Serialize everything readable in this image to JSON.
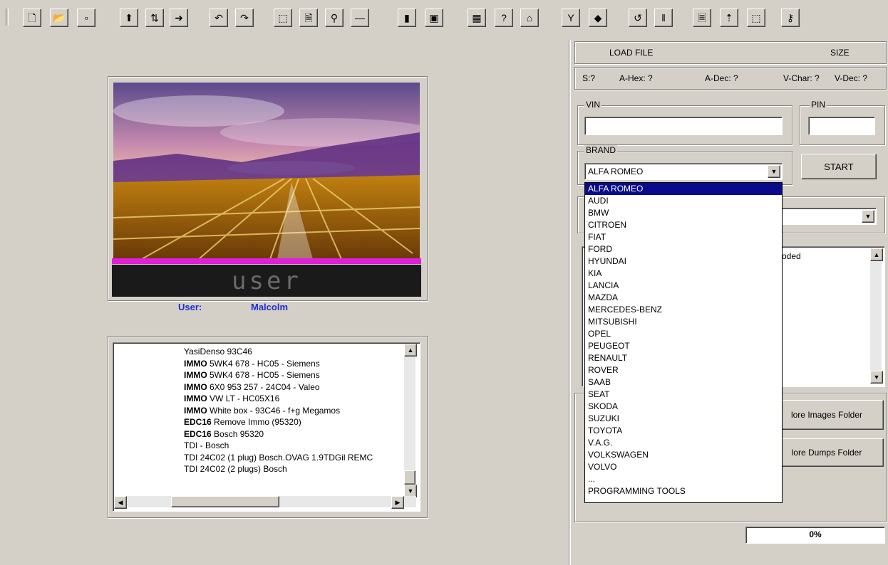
{
  "toolbar": {
    "buttons": [
      {
        "name": "new-file",
        "glyph": "🗋"
      },
      {
        "name": "open-folder",
        "glyph": "📂"
      },
      {
        "name": "disabled-1",
        "glyph": "▫"
      },
      {
        "name": "import",
        "glyph": "⬆"
      },
      {
        "name": "transfer",
        "glyph": "⇅"
      },
      {
        "name": "export",
        "glyph": "➜"
      },
      {
        "name": "undo",
        "glyph": "↶"
      },
      {
        "name": "redo",
        "glyph": "↷"
      },
      {
        "name": "select",
        "glyph": "⬚"
      },
      {
        "name": "page",
        "glyph": "🗎"
      },
      {
        "name": "find",
        "glyph": "⚲"
      },
      {
        "name": "minus",
        "glyph": "—"
      },
      {
        "name": "chip",
        "glyph": "▮"
      },
      {
        "name": "window",
        "glyph": "▣"
      },
      {
        "name": "calc",
        "glyph": "▦"
      },
      {
        "name": "help",
        "glyph": "?"
      },
      {
        "name": "book",
        "glyph": "⌂"
      },
      {
        "name": "tools",
        "glyph": "Y"
      },
      {
        "name": "chip-dark",
        "glyph": "◆"
      },
      {
        "name": "refresh",
        "glyph": "↺"
      },
      {
        "name": "columns",
        "glyph": "‖"
      },
      {
        "name": "document",
        "glyph": "🗏"
      },
      {
        "name": "pointer",
        "glyph": "⇡"
      },
      {
        "name": "marquee",
        "glyph": "⬚"
      },
      {
        "name": "key",
        "glyph": "⚷"
      }
    ]
  },
  "splash": {
    "banner_text": "user",
    "user_label": "User:",
    "user_name": "Malcolm"
  },
  "file_list": {
    "items": [
      {
        "bold": "",
        "text": "YasiDenso  93C46"
      },
      {
        "bold": "IMMO",
        "text": " 5WK4 678    - HC05 - Siemens"
      },
      {
        "bold": "IMMO",
        "text": " 5WK4 678    - HC05 - Siemens"
      },
      {
        "bold": "IMMO",
        "text": " 6X0 953 257 - 24C04 - Valeo"
      },
      {
        "bold": "IMMO",
        "text": " VW LT      - HC05X16"
      },
      {
        "bold": "IMMO",
        "text": " White box  - 93C46 - f+g Megamos"
      },
      {
        "bold": "EDC16",
        "text": "  Remove Immo (95320)"
      },
      {
        "bold": "EDC16",
        "text": " Bosch 95320"
      },
      {
        "bold": "",
        "text": "TDI - Bosch"
      },
      {
        "bold": "",
        "text": "TDI 24C02 (1 plug) Bosch.OVAG 1.9TDGil REMC"
      },
      {
        "bold": "",
        "text": "TDI 24C02 (2 plugs) Bosch"
      }
    ]
  },
  "right": {
    "load_file": "LOAD FILE",
    "size": "SIZE",
    "s_label": "S:?",
    "ahex": "A-Hex: ?",
    "adec": "A-Dec: ?",
    "vchar": "V-Char: ?",
    "vdec": "V-Dec: ?",
    "vin_label": "VIN",
    "vin_value": "",
    "pin_label": "PIN",
    "pin_value": "",
    "brand_label": "BRAND",
    "brand_selected": "ALFA ROMEO",
    "start_label": "START",
    "log_partial": "oded",
    "images_btn": "lore Images Folder",
    "dumps_btn": "lore Dumps Folder",
    "progress": "0%"
  },
  "brands": [
    "ALFA ROMEO",
    "AUDI",
    "BMW",
    "CITROEN",
    "FIAT",
    "FORD",
    "HYUNDAI",
    "KIA",
    "LANCIA",
    "MAZDA",
    "MERCEDES-BENZ",
    "MITSUBISHI",
    "OPEL",
    "PEUGEOT",
    "RENAULT",
    "ROVER",
    "SAAB",
    "SEAT",
    "SKODA",
    "SUZUKI",
    "TOYOTA",
    "V.A.G.",
    "VOLKSWAGEN",
    "VOLVO",
    "...",
    "PROGRAMMING TOOLS"
  ]
}
